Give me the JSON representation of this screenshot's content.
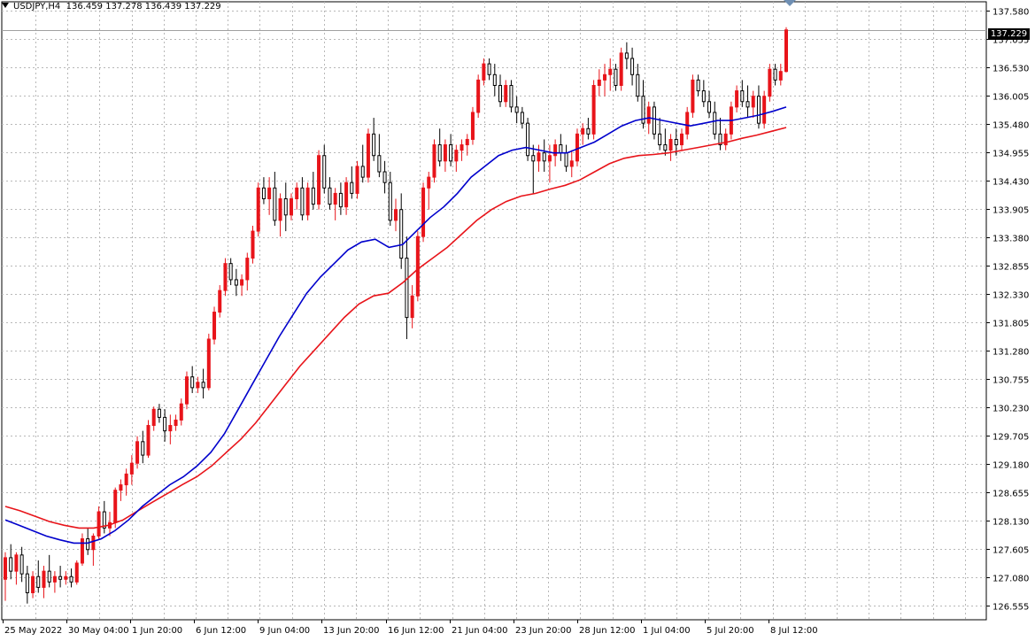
{
  "header": {
    "symbol": "USDJPY,H4",
    "open": "136.459",
    "high": "137.278",
    "low": "136.439",
    "close": "137.229"
  },
  "current_price_tag": "137.229",
  "colors": {
    "bull_candle": "#e8141a",
    "bear_candle": "#000000",
    "ma_fast": "#0000cc",
    "ma_slow": "#e8141a",
    "grid": "#b8b8b8"
  },
  "chart_data": {
    "type": "candlestick",
    "title": "USDJPY,H4",
    "ylim": [
      126.3,
      137.75
    ],
    "y_ticks": [
      "137.580",
      "137.055",
      "136.530",
      "136.005",
      "135.480",
      "134.955",
      "134.430",
      "133.905",
      "133.380",
      "132.855",
      "132.330",
      "131.805",
      "131.280",
      "130.755",
      "130.230",
      "129.705",
      "129.180",
      "128.655",
      "128.130",
      "127.605",
      "127.080",
      "126.555"
    ],
    "x_labels": [
      "25 May 2022",
      "30 May 04:00",
      "1 Jun 20:00",
      "6 Jun 12:00",
      "9 Jun 04:00",
      "13 Jun 20:00",
      "16 Jun 12:00",
      "21 Jun 04:00",
      "23 Jun 20:00",
      "28 Jun 12:00",
      "1 Jul 04:00",
      "5 Jul 20:00",
      "8 Jul 12:00"
    ],
    "grid": true,
    "price_line": 137.229,
    "candles_ohlc": [
      [
        127.05,
        127.55,
        126.65,
        127.45
      ],
      [
        127.45,
        127.7,
        127.05,
        127.2
      ],
      [
        127.2,
        127.55,
        126.95,
        127.5
      ],
      [
        127.5,
        127.65,
        127.0,
        127.15
      ],
      [
        127.15,
        127.3,
        126.6,
        126.8
      ],
      [
        126.8,
        127.2,
        126.7,
        127.1
      ],
      [
        127.1,
        127.4,
        126.8,
        126.9
      ],
      [
        126.9,
        127.3,
        126.7,
        127.2
      ],
      [
        127.2,
        127.5,
        126.9,
        127.0
      ],
      [
        127.0,
        127.2,
        126.8,
        127.1
      ],
      [
        127.1,
        127.3,
        126.9,
        127.05
      ],
      [
        127.05,
        127.2,
        126.95,
        127.1
      ],
      [
        127.1,
        127.25,
        126.9,
        127.0
      ],
      [
        127.0,
        127.4,
        126.95,
        127.35
      ],
      [
        127.35,
        127.9,
        127.3,
        127.8
      ],
      [
        127.8,
        128.0,
        127.5,
        127.6
      ],
      [
        127.6,
        127.9,
        127.3,
        127.85
      ],
      [
        127.85,
        128.4,
        127.8,
        128.3
      ],
      [
        128.3,
        128.5,
        127.9,
        128.0
      ],
      [
        128.0,
        128.3,
        127.85,
        128.1
      ],
      [
        128.1,
        128.75,
        128.0,
        128.7
      ],
      [
        128.7,
        128.9,
        128.5,
        128.8
      ],
      [
        128.8,
        129.1,
        128.6,
        129.0
      ],
      [
        129.0,
        129.35,
        128.8,
        129.2
      ],
      [
        129.2,
        129.7,
        129.1,
        129.6
      ],
      [
        129.6,
        129.8,
        129.2,
        129.35
      ],
      [
        129.35,
        130.0,
        129.3,
        129.9
      ],
      [
        129.9,
        130.25,
        129.8,
        130.2
      ],
      [
        130.2,
        130.3,
        129.95,
        130.05
      ],
      [
        130.05,
        130.2,
        129.6,
        129.8
      ],
      [
        129.8,
        130.1,
        129.55,
        129.9
      ],
      [
        129.9,
        130.1,
        129.8,
        130.0
      ],
      [
        130.0,
        130.4,
        129.9,
        130.3
      ],
      [
        130.3,
        130.9,
        130.2,
        130.8
      ],
      [
        130.8,
        131.0,
        130.5,
        130.6
      ],
      [
        130.6,
        130.8,
        130.5,
        130.7
      ],
      [
        130.7,
        130.95,
        130.4,
        130.6
      ],
      [
        130.6,
        131.6,
        130.55,
        131.5
      ],
      [
        131.5,
        132.1,
        131.4,
        132.0
      ],
      [
        132.0,
        132.5,
        131.9,
        132.4
      ],
      [
        132.4,
        133.0,
        132.3,
        132.9
      ],
      [
        132.9,
        133.0,
        132.5,
        132.6
      ],
      [
        132.6,
        132.8,
        132.3,
        132.5
      ],
      [
        132.5,
        132.7,
        132.3,
        132.6
      ],
      [
        132.6,
        133.1,
        132.4,
        133.0
      ],
      [
        133.0,
        133.6,
        132.9,
        133.5
      ],
      [
        133.5,
        134.4,
        133.4,
        134.3
      ],
      [
        134.3,
        134.5,
        134.0,
        134.1
      ],
      [
        134.1,
        134.5,
        133.8,
        134.3
      ],
      [
        134.3,
        134.6,
        133.6,
        133.7
      ],
      [
        133.7,
        134.2,
        133.4,
        134.1
      ],
      [
        134.1,
        134.4,
        133.5,
        133.8
      ],
      [
        133.8,
        134.2,
        133.7,
        134.1
      ],
      [
        134.1,
        134.4,
        133.9,
        134.3
      ],
      [
        134.3,
        134.5,
        133.7,
        133.8
      ],
      [
        133.8,
        134.4,
        133.7,
        134.3
      ],
      [
        134.3,
        134.6,
        133.9,
        134.0
      ],
      [
        134.0,
        135.0,
        133.9,
        134.9
      ],
      [
        134.9,
        135.1,
        134.2,
        134.3
      ],
      [
        134.3,
        134.5,
        133.9,
        134.0
      ],
      [
        134.0,
        134.3,
        133.7,
        134.2
      ],
      [
        134.2,
        134.4,
        133.8,
        133.95
      ],
      [
        133.95,
        134.5,
        133.8,
        134.4
      ],
      [
        134.4,
        134.7,
        134.1,
        134.2
      ],
      [
        134.2,
        134.8,
        134.1,
        134.7
      ],
      [
        134.7,
        135.1,
        134.4,
        134.5
      ],
      [
        134.5,
        135.4,
        134.4,
        135.3
      ],
      [
        135.3,
        135.6,
        134.8,
        134.9
      ],
      [
        134.9,
        135.3,
        134.5,
        134.6
      ],
      [
        134.6,
        134.8,
        134.2,
        134.4
      ],
      [
        134.4,
        134.6,
        133.6,
        133.7
      ],
      [
        133.7,
        134.1,
        133.5,
        133.9
      ],
      [
        133.9,
        134.2,
        132.8,
        133.0
      ],
      [
        133.0,
        133.4,
        131.5,
        131.9
      ],
      [
        131.9,
        132.5,
        131.7,
        132.3
      ],
      [
        132.3,
        133.5,
        132.2,
        133.4
      ],
      [
        133.4,
        134.4,
        133.3,
        134.3
      ],
      [
        134.3,
        134.6,
        133.9,
        134.5
      ],
      [
        134.5,
        135.2,
        134.4,
        135.1
      ],
      [
        135.1,
        135.4,
        134.7,
        134.8
      ],
      [
        134.8,
        135.2,
        134.6,
        135.1
      ],
      [
        135.1,
        135.3,
        134.7,
        134.8
      ],
      [
        134.8,
        135.1,
        134.6,
        135.0
      ],
      [
        135.0,
        135.2,
        134.8,
        135.1
      ],
      [
        135.1,
        135.3,
        134.9,
        135.2
      ],
      [
        135.2,
        135.8,
        135.1,
        135.7
      ],
      [
        135.7,
        136.4,
        135.6,
        136.3
      ],
      [
        136.3,
        136.7,
        136.2,
        136.6
      ],
      [
        136.6,
        136.7,
        136.3,
        136.4
      ],
      [
        136.4,
        136.6,
        136.0,
        136.2
      ],
      [
        136.2,
        136.4,
        135.8,
        135.9
      ],
      [
        135.9,
        136.3,
        135.8,
        136.2
      ],
      [
        136.2,
        136.3,
        135.7,
        135.8
      ],
      [
        135.8,
        136.0,
        135.5,
        135.7
      ],
      [
        135.7,
        135.8,
        135.4,
        135.5
      ],
      [
        135.5,
        135.6,
        134.8,
        134.9
      ],
      [
        134.9,
        135.1,
        134.2,
        134.8
      ],
      [
        134.8,
        135.1,
        134.6,
        134.95
      ],
      [
        134.95,
        135.2,
        134.6,
        134.8
      ],
      [
        134.8,
        135.1,
        134.4,
        134.9
      ],
      [
        134.9,
        135.2,
        134.7,
        135.1
      ],
      [
        135.1,
        135.3,
        134.8,
        134.95
      ],
      [
        134.95,
        135.1,
        134.6,
        134.7
      ],
      [
        134.7,
        135.0,
        134.5,
        134.8
      ],
      [
        134.8,
        135.4,
        134.7,
        135.3
      ],
      [
        135.3,
        135.5,
        135.1,
        135.4
      ],
      [
        135.4,
        135.6,
        135.2,
        135.3
      ],
      [
        135.3,
        136.3,
        135.2,
        136.2
      ],
      [
        136.2,
        136.5,
        136.0,
        136.3
      ],
      [
        136.3,
        136.6,
        136.0,
        136.4
      ],
      [
        136.4,
        136.7,
        136.1,
        136.5
      ],
      [
        136.5,
        136.6,
        136.1,
        136.2
      ],
      [
        136.2,
        136.9,
        136.1,
        136.8
      ],
      [
        136.8,
        137.0,
        136.5,
        136.7
      ],
      [
        136.7,
        136.9,
        136.2,
        136.4
      ],
      [
        136.4,
        136.6,
        135.9,
        136.0
      ],
      [
        136.0,
        136.3,
        135.4,
        135.5
      ],
      [
        135.5,
        135.9,
        135.3,
        135.8
      ],
      [
        135.8,
        135.9,
        135.2,
        135.3
      ],
      [
        135.3,
        135.6,
        135.0,
        135.1
      ],
      [
        135.1,
        135.4,
        134.9,
        135.0
      ],
      [
        135.0,
        135.3,
        134.8,
        135.2
      ],
      [
        135.2,
        135.4,
        134.9,
        135.1
      ],
      [
        135.1,
        135.4,
        135.0,
        135.3
      ],
      [
        135.3,
        135.8,
        135.2,
        135.7
      ],
      [
        135.7,
        136.4,
        135.6,
        136.3
      ],
      [
        136.3,
        136.4,
        136.0,
        136.1
      ],
      [
        136.1,
        136.3,
        135.8,
        135.9
      ],
      [
        135.9,
        136.1,
        135.6,
        135.7
      ],
      [
        135.7,
        135.9,
        135.2,
        135.3
      ],
      [
        135.3,
        135.6,
        135.0,
        135.1
      ],
      [
        135.1,
        135.4,
        135.0,
        135.3
      ],
      [
        135.3,
        135.9,
        135.2,
        135.8
      ],
      [
        135.8,
        136.2,
        135.7,
        136.1
      ],
      [
        136.1,
        136.3,
        135.8,
        135.9
      ],
      [
        135.9,
        136.2,
        135.6,
        135.8
      ],
      [
        135.8,
        136.1,
        135.6,
        136.0
      ],
      [
        136.0,
        136.2,
        135.4,
        135.5
      ],
      [
        135.5,
        136.1,
        135.4,
        136.0
      ],
      [
        136.0,
        136.6,
        135.9,
        136.5
      ],
      [
        136.5,
        136.6,
        136.2,
        136.3
      ],
      [
        136.3,
        136.6,
        136.2,
        136.459
      ],
      [
        136.459,
        137.278,
        136.439,
        137.229
      ]
    ],
    "ma_fast": [
      128.15,
      128.05,
      127.95,
      127.85,
      127.78,
      127.72,
      127.72,
      127.8,
      127.95,
      128.15,
      128.4,
      128.6,
      128.8,
      128.95,
      129.15,
      129.4,
      129.75,
      130.2,
      130.65,
      131.1,
      131.55,
      131.95,
      132.35,
      132.65,
      132.9,
      133.15,
      133.3,
      133.35,
      133.2,
      133.25,
      133.5,
      133.75,
      133.95,
      134.2,
      134.5,
      134.7,
      134.9,
      135.0,
      135.05,
      135.0,
      134.95,
      134.95,
      135.05,
      135.15,
      135.3,
      135.45,
      135.55,
      135.6,
      135.55,
      135.5,
      135.45,
      135.5,
      135.55,
      135.55,
      135.6,
      135.65,
      135.72,
      135.8
    ],
    "ma_slow": [
      128.4,
      128.32,
      128.22,
      128.12,
      128.05,
      128.0,
      128.0,
      128.05,
      128.15,
      128.32,
      128.48,
      128.64,
      128.8,
      128.95,
      129.15,
      129.4,
      129.65,
      129.95,
      130.3,
      130.65,
      131.0,
      131.3,
      131.6,
      131.9,
      132.15,
      132.3,
      132.35,
      132.55,
      132.8,
      133.0,
      133.2,
      133.45,
      133.7,
      133.9,
      134.05,
      134.15,
      134.2,
      134.28,
      134.35,
      134.45,
      134.6,
      134.75,
      134.85,
      134.9,
      134.92,
      134.95,
      135.0,
      135.05,
      135.1,
      135.15,
      135.22,
      135.28,
      135.35,
      135.42
    ]
  }
}
